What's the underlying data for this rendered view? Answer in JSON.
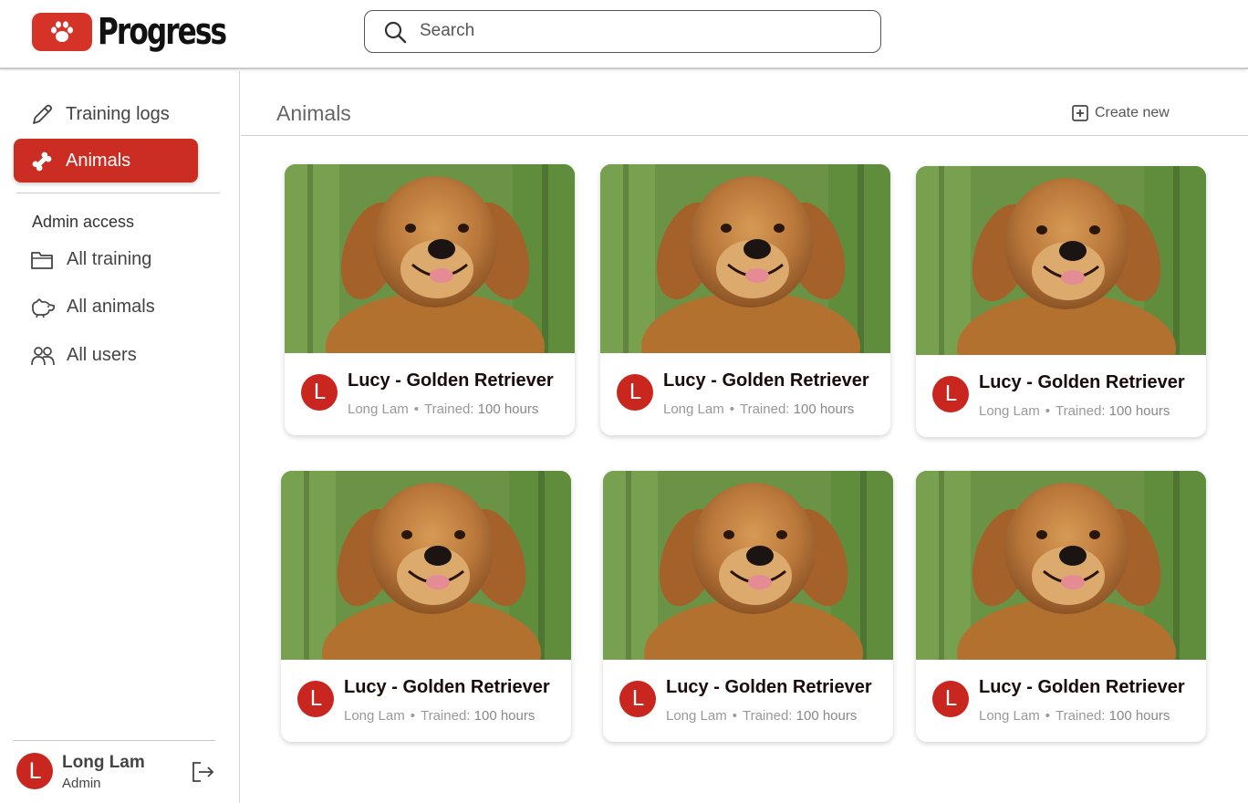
{
  "app": {
    "logo_text": "Progress",
    "brand_color": "#cc2d23"
  },
  "search": {
    "placeholder": "Search"
  },
  "sidebar": {
    "items": [
      {
        "label": "Training logs",
        "icon": "pencil-icon"
      },
      {
        "label": "Animals",
        "icon": "bone-icon",
        "active": true
      }
    ],
    "admin_section_label": "Admin access",
    "admin_items": [
      {
        "label": "All training",
        "icon": "folder-icon"
      },
      {
        "label": "All animals",
        "icon": "dog-icon"
      },
      {
        "label": "All users",
        "icon": "users-icon"
      }
    ],
    "user": {
      "initial": "L",
      "name": "Long Lam",
      "role": "Admin"
    }
  },
  "main": {
    "title": "Animals",
    "create_label": "Create new",
    "cards": [
      {
        "initial": "L",
        "title": "Lucy - Golden Retriever",
        "owner": "Long Lam",
        "trained_label": "Trained:",
        "trained_value": "100 hours"
      },
      {
        "initial": "L",
        "title": "Lucy - Golden Retriever",
        "owner": "Long Lam",
        "trained_label": "Trained:",
        "trained_value": "100 hours"
      },
      {
        "initial": "L",
        "title": "Lucy - Golden Retriever",
        "owner": "Long Lam",
        "trained_label": "Trained:",
        "trained_value": "100 hours"
      },
      {
        "initial": "L",
        "title": "Lucy - Golden Retriever",
        "owner": "Long Lam",
        "trained_label": "Trained:",
        "trained_value": "100 hours"
      },
      {
        "initial": "L",
        "title": "Lucy - Golden Retriever",
        "owner": "Long Lam",
        "trained_label": "Trained:",
        "trained_value": "100 hours"
      },
      {
        "initial": "L",
        "title": "Lucy - Golden Retriever",
        "owner": "Long Lam",
        "trained_label": "Trained:",
        "trained_value": "100 hours"
      }
    ]
  }
}
